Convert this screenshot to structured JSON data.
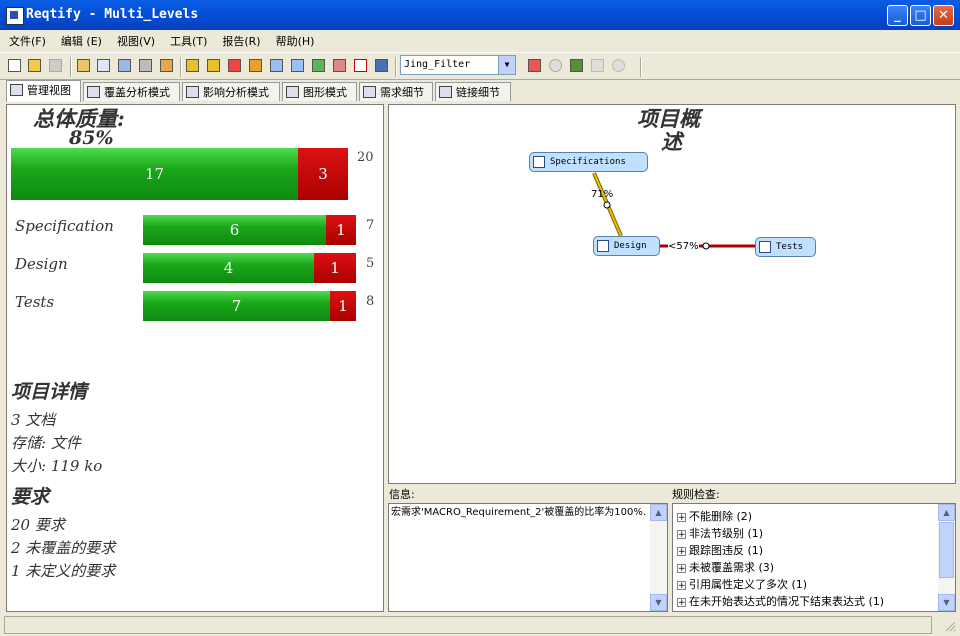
{
  "window": {
    "title": "Reqtify - Multi_Levels"
  },
  "menu": [
    "文件(F)",
    "编辑 (E)",
    "视图(V)",
    "工具(T)",
    "报告(R)",
    "帮助(H)"
  ],
  "toolbar": {
    "filter_value": "Jing_Filter"
  },
  "tabs": [
    "管理视图",
    "覆盖分析模式",
    "影响分析模式",
    "图形模式",
    "需求细节",
    "链接细节"
  ],
  "overview": {
    "title_line1": "总体质量:",
    "title_line2": "85%",
    "total": {
      "covered": 17,
      "uncovered": 3,
      "total": "20"
    },
    "docs": [
      {
        "name": "Specification",
        "covered": 6,
        "uncovered": 1,
        "total": "7"
      },
      {
        "name": "Design",
        "covered": 4,
        "uncovered": 1,
        "total": "5"
      },
      {
        "name": "Tests",
        "covered": 7,
        "uncovered": 1,
        "total": "8"
      }
    ],
    "details_heading": "项目详情",
    "details": [
      "3 文档",
      "存储: 文件",
      "大小: 119 ko"
    ],
    "req_heading": "要求",
    "reqs": [
      "20 要求",
      "2 未覆盖的要求",
      "1 未定义的要求"
    ]
  },
  "graph": {
    "title_line1": "项目概",
    "title_line2": "述",
    "nodes": {
      "spec": "Specifications",
      "design": "Design",
      "tests": "Tests"
    },
    "link1": "71%",
    "link2": "<57%"
  },
  "info": {
    "label": "信息:",
    "text": "宏需求'MACRO_Requirement_2'被覆盖的比率为100%."
  },
  "rules": {
    "label": "规则检查:",
    "items": [
      "不能删除 (2)",
      "非法节级别 (1)",
      "跟踪图违反 (1)",
      "未被覆盖需求 (3)",
      "引用属性定义了多次 (1)",
      "在未开始表达式的情况下结束表达式 (1)"
    ]
  },
  "colors": {
    "covered": "#1aa71a",
    "uncovered": "#aa0000",
    "link": "#f0c000",
    "link_bad": "#aa0000"
  }
}
